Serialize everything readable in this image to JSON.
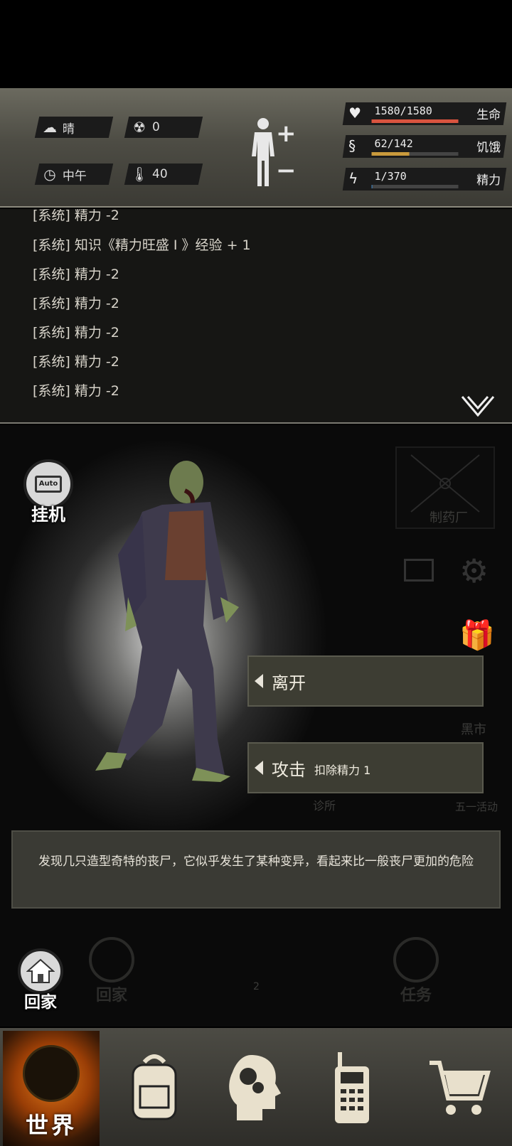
{
  "status": {
    "weather": {
      "icon": "cloud-sun-icon",
      "label": "晴"
    },
    "radiation": {
      "icon": "radiation-icon",
      "value": "0"
    },
    "time": {
      "icon": "clock-icon",
      "label": "中午"
    },
    "temperature": {
      "icon": "thermometer-icon",
      "value": "40"
    },
    "stats": [
      {
        "icon": "heart-icon",
        "value": "1580/1580",
        "label": "生命",
        "fraction": 1.0,
        "color": "#d9543f"
      },
      {
        "icon": "stomach-icon",
        "value": "62/142",
        "label": "饥饿",
        "fraction": 0.437,
        "color": "#c99a3c"
      },
      {
        "icon": "brain-energy-icon",
        "value": "1/370",
        "label": "精力",
        "fraction": 0.003,
        "color": "#3c88c9"
      }
    ]
  },
  "log": {
    "lines": [
      "[系统] 精力 -2",
      "[系统] 知识《精力旺盛 I 》经验 + 1",
      "[系统] 精力 -2",
      "[系统] 精力 -2",
      "[系统] 精力 -2",
      "[系统] 精力 -2",
      "[系统] 精力 -2"
    ]
  },
  "scene": {
    "auto": {
      "screen": "Auto",
      "label": "挂机"
    },
    "pharmacy_label": "制药厂",
    "black_market_label": "黑市",
    "event_label": "五一活动",
    "clinic_label": "诊所",
    "actions": [
      {
        "label": "离开",
        "sub": ""
      },
      {
        "label": "攻击",
        "sub": "扣除精力 1"
      }
    ],
    "description": "发现几只造型奇特的丧尸，它似乎发生了某种变异，看起来比一般丧尸更加的危险",
    "home_label": "回家",
    "ghost_home_label": "回家",
    "ghost_task_label": "任务",
    "ghost_counter": "2"
  },
  "nav": {
    "world_label": "世界",
    "items": [
      "backpack-icon",
      "skills-head-icon",
      "radio-icon",
      "cart-icon"
    ]
  }
}
